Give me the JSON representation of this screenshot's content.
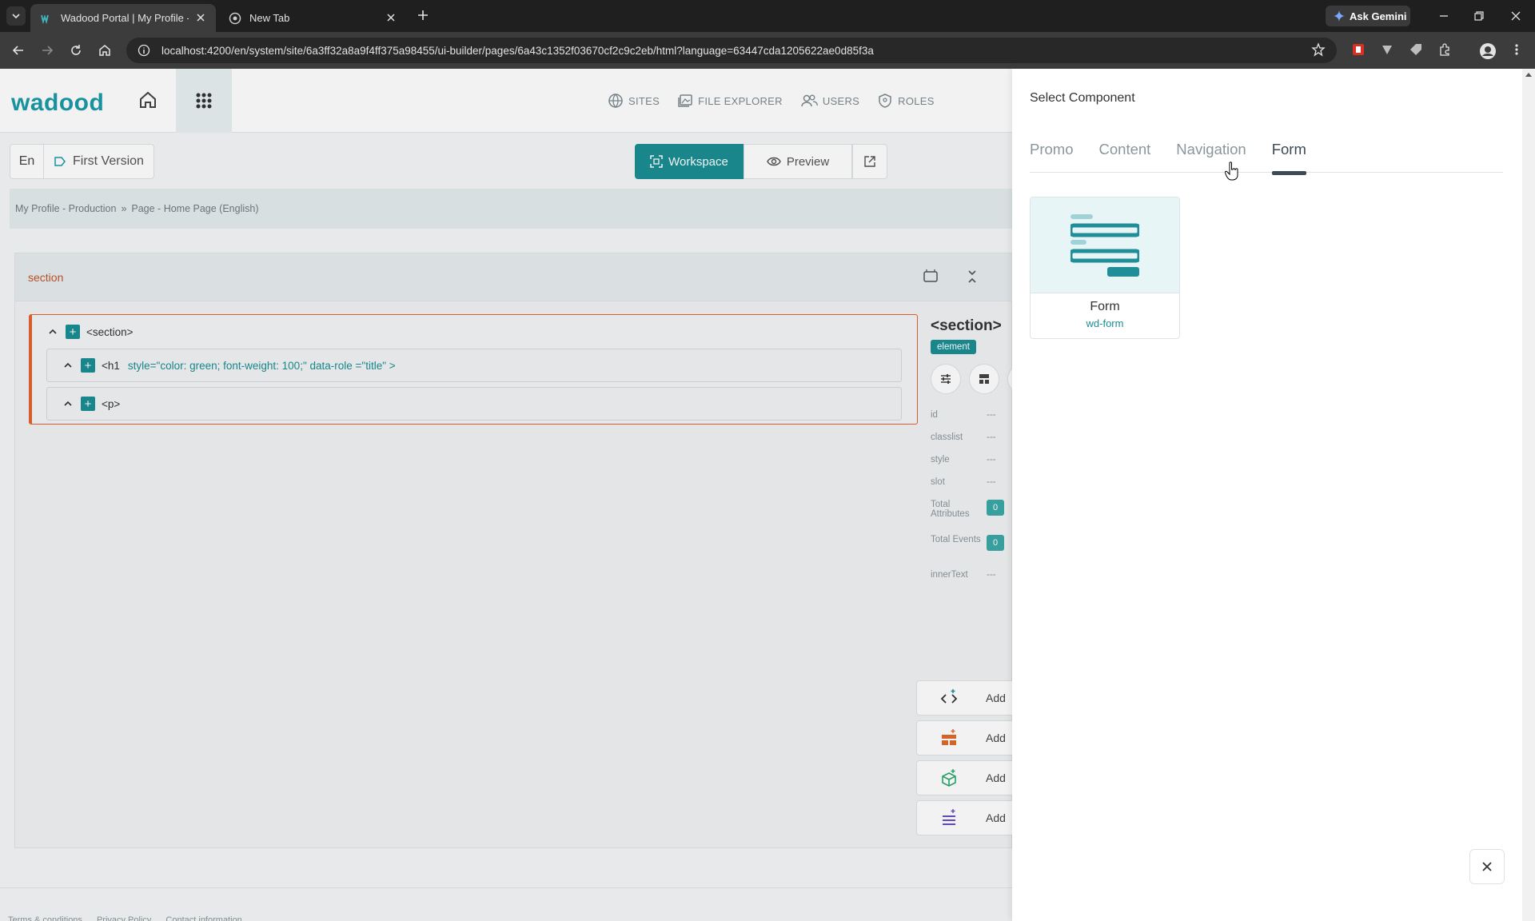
{
  "browser": {
    "tabs": [
      {
        "title": "Wadood Portal | My Profile - Ui",
        "active": true
      },
      {
        "title": "New Tab",
        "active": false
      }
    ],
    "ask_gemini": "Ask Gemini",
    "url": "localhost:4200/en/system/site/6a3ff32a8a9f4ff375a98455/ui-builder/pages/6a43c1352f03670cf2c9c2eb/html?language=63447cda1205622ae0d85f3a"
  },
  "app": {
    "logo": "wadood",
    "nav": [
      "SITES",
      "FILE EXPLORER",
      "USERS",
      "ROLES"
    ],
    "language": "En",
    "version": "First Version",
    "modes": {
      "workspace": "Workspace",
      "preview": "Preview"
    },
    "breadcrumb": [
      "My Profile - Production",
      "»",
      "Page - Home Page (English)"
    ]
  },
  "editor": {
    "section_label": "section",
    "tree": {
      "root": "<section>",
      "children": [
        {
          "tag": "<h1",
          "attrs": "style=\"color: green; font-weight: 100;\"   data-role =\"title\" >"
        },
        {
          "tag": "<p>",
          "attrs": ""
        }
      ]
    },
    "props": {
      "tag": "<section>",
      "badge": "element",
      "rows": [
        {
          "k": "id",
          "v": "---"
        },
        {
          "k": "classlist",
          "v": "---"
        },
        {
          "k": "style",
          "v": "---"
        },
        {
          "k": "slot",
          "v": "---"
        }
      ],
      "total_attributes_label": "Total Attributes",
      "total_attributes": "0",
      "total_events_label": "Total Events",
      "total_events": "0",
      "innertext_label": "innerText",
      "innertext": "---"
    },
    "add_buttons": [
      "Add",
      "Add",
      "Add",
      "Add"
    ]
  },
  "footer": [
    "Terms & conditions",
    "Privacy Policy",
    "Contact information"
  ],
  "drawer": {
    "title": "Select Component",
    "tabs": [
      "Promo",
      "Content",
      "Navigation",
      "Form"
    ],
    "active_tab": "Form",
    "components": [
      {
        "name": "Form",
        "tag": "wd-form"
      }
    ]
  },
  "colors": {
    "accent": "#1a8e93",
    "section": "#c0562a",
    "brand": "#1a9aa8"
  }
}
